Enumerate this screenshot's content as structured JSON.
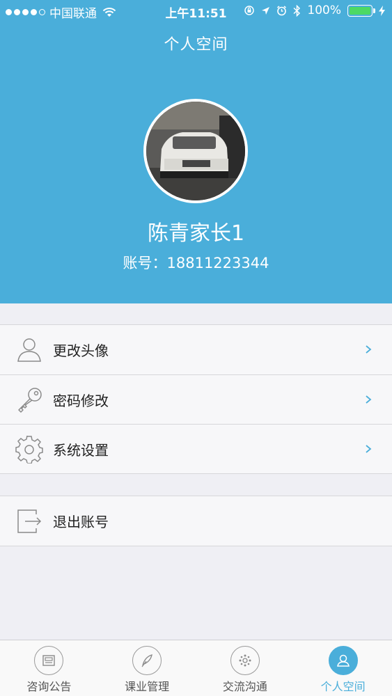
{
  "status_bar": {
    "carrier": "中国联通",
    "time": "上午11:51",
    "battery": "100%"
  },
  "header": {
    "title": "个人空间",
    "user_name": "陈青家长1",
    "account": "账号：18811223344"
  },
  "menu": {
    "items": [
      {
        "label": "更改头像",
        "icon": "user-icon"
      },
      {
        "label": "密码修改",
        "icon": "key-icon"
      },
      {
        "label": "系统设置",
        "icon": "gear-icon"
      }
    ],
    "logout": {
      "label": "退出账号",
      "icon": "logout-icon"
    }
  },
  "tabbar": {
    "tabs": [
      {
        "label": "咨询公告",
        "icon": "newspaper-icon",
        "active": false
      },
      {
        "label": "课业管理",
        "icon": "feather-icon",
        "active": false
      },
      {
        "label": "交流沟通",
        "icon": "chat-icon",
        "active": false
      },
      {
        "label": "个人空间",
        "icon": "person-icon",
        "active": true
      }
    ]
  },
  "colors": {
    "accent": "#4aaeda",
    "background": "#efeff4",
    "battery": "#4cd964"
  }
}
